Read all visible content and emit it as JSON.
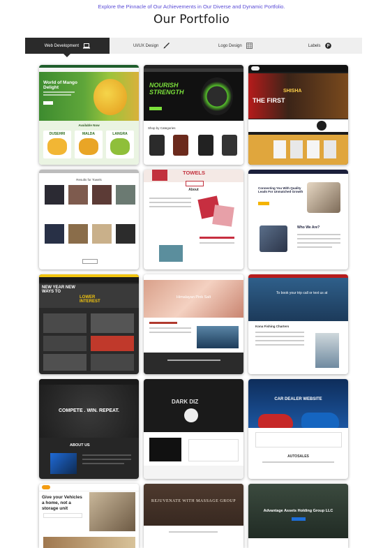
{
  "header": {
    "tagline": "Explore the Pinnacle of Our Achievements in Our Diverse and Dynamic Portfolio.",
    "title": "Our Portfolio"
  },
  "tabs": [
    {
      "label": "Web Development",
      "icon": "laptop-icon",
      "active": true
    },
    {
      "label": "UI/UX Design",
      "icon": "brush-icon",
      "active": false
    },
    {
      "label": "Logo Design",
      "icon": "grid-icon",
      "active": false
    },
    {
      "label": "Labels",
      "icon": "p-badge-icon",
      "active": false
    }
  ],
  "cards": [
    {
      "name": "portfolio-mango",
      "text": "World of Mango Delight",
      "sub": "Available Now",
      "items": [
        "DUSEHRI",
        "MALDA",
        "LANGRA"
      ]
    },
    {
      "name": "portfolio-nourish",
      "text": "NOURISH STRENGTH",
      "sub": "Shop by Categories"
    },
    {
      "name": "portfolio-shisha",
      "text": "SHISHA",
      "sub": "THE FIRST"
    },
    {
      "name": "portfolio-towels-shop",
      "text": "Results for Towels"
    },
    {
      "name": "portfolio-towels",
      "text": "TOWELS",
      "sub": "About"
    },
    {
      "name": "portfolio-leads",
      "text": "Connecting You With Quality Leads For Unmatched Growth",
      "sub": "Who We Are?"
    },
    {
      "name": "portfolio-guns",
      "text": "NEW YEAR NEW WAYS TO",
      "sub": "LOWER INTEREST"
    },
    {
      "name": "portfolio-salt",
      "text": "Himalayan Pink Salt"
    },
    {
      "name": "portfolio-fishing",
      "text": "To book your trip call or text us at",
      "sub": "Kona Fishing Charters"
    },
    {
      "name": "portfolio-compete",
      "text": "COMPETE . WIN. REPEAT.",
      "sub": "ABOUT US"
    },
    {
      "name": "portfolio-darkdiz",
      "text": "DARK DIZ"
    },
    {
      "name": "portfolio-car-dealer",
      "text": "CAR DEALER WEBSITE",
      "sub": "AUTOSALES"
    },
    {
      "name": "portfolio-storage",
      "text": "Give your Vehicles a home, not a storage unit"
    },
    {
      "name": "portfolio-massage",
      "text": "REJUVENATE WITH MASSAGE GROUP"
    },
    {
      "name": "portfolio-advantage",
      "text": "Advantage Assets Holding Group LLC"
    }
  ]
}
